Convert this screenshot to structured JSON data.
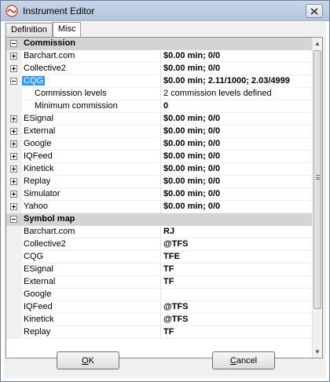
{
  "window": {
    "title": "Instrument Editor",
    "close_label": "✕"
  },
  "tabs": [
    {
      "label": "Definition",
      "active": false
    },
    {
      "label": "Misc",
      "active": true
    }
  ],
  "grid": {
    "rows": [
      {
        "type": "cat",
        "name": "Commission",
        "expander": "minus"
      },
      {
        "type": "item",
        "name": "Barchart.com",
        "value": "$0.00 min;  0/0",
        "bold": true,
        "expander": "plus"
      },
      {
        "type": "item",
        "name": "Collective2",
        "value": "$0.00 min;  0/0",
        "bold": true,
        "expander": "plus"
      },
      {
        "type": "item",
        "name": "CQG",
        "value": "$0.00 min; 2.11/1000; 2.03/4999",
        "bold": true,
        "expander": "minus",
        "selected": true
      },
      {
        "type": "child",
        "name": "Commission levels",
        "value": "2 commission levels defined",
        "bold": false
      },
      {
        "type": "child",
        "name": "Minimum commission",
        "value": "0",
        "bold": true
      },
      {
        "type": "item",
        "name": "ESignal",
        "value": "$0.00 min;  0/0",
        "bold": true,
        "expander": "plus"
      },
      {
        "type": "item",
        "name": "External",
        "value": "$0.00 min;  0/0",
        "bold": true,
        "expander": "plus"
      },
      {
        "type": "item",
        "name": "Google",
        "value": "$0.00 min;  0/0",
        "bold": true,
        "expander": "plus"
      },
      {
        "type": "item",
        "name": "IQFeed",
        "value": "$0.00 min;  0/0",
        "bold": true,
        "expander": "plus"
      },
      {
        "type": "item",
        "name": "Kinetick",
        "value": "$0.00 min;  0/0",
        "bold": true,
        "expander": "plus"
      },
      {
        "type": "item",
        "name": "Replay",
        "value": "$0.00 min;  0/0",
        "bold": true,
        "expander": "plus"
      },
      {
        "type": "item",
        "name": "Simulator",
        "value": "$0.00 min;  0/0",
        "bold": true,
        "expander": "plus"
      },
      {
        "type": "item",
        "name": "Yahoo",
        "value": "$0.00 min;  0/0",
        "bold": true,
        "expander": "plus"
      },
      {
        "type": "cat",
        "name": "Symbol map",
        "expander": "minus"
      },
      {
        "type": "item",
        "name": "Barchart.com",
        "value": "RJ",
        "bold": true
      },
      {
        "type": "item",
        "name": "Collective2",
        "value": "@TFS",
        "bold": true
      },
      {
        "type": "item",
        "name": "CQG",
        "value": "TFE",
        "bold": true
      },
      {
        "type": "item",
        "name": "ESignal",
        "value": "TF",
        "bold": true
      },
      {
        "type": "item",
        "name": "External",
        "value": "TF",
        "bold": true
      },
      {
        "type": "item",
        "name": "Google",
        "value": "",
        "bold": true
      },
      {
        "type": "item",
        "name": "IQFeed",
        "value": "@TFS",
        "bold": true
      },
      {
        "type": "item",
        "name": "Kinetick",
        "value": "@TFS",
        "bold": true
      },
      {
        "type": "item",
        "name": "Replay",
        "value": "TF",
        "bold": true
      }
    ]
  },
  "buttons": {
    "ok": {
      "accel": "O",
      "rest": "K"
    },
    "cancel": {
      "accel": "C",
      "rest": "ancel"
    }
  },
  "colors": {
    "selection": "#3399ff",
    "category_bg": "#d4d4d4",
    "gutter_bg": "#f0f0f0",
    "window_bg": "#f0f0f0"
  }
}
